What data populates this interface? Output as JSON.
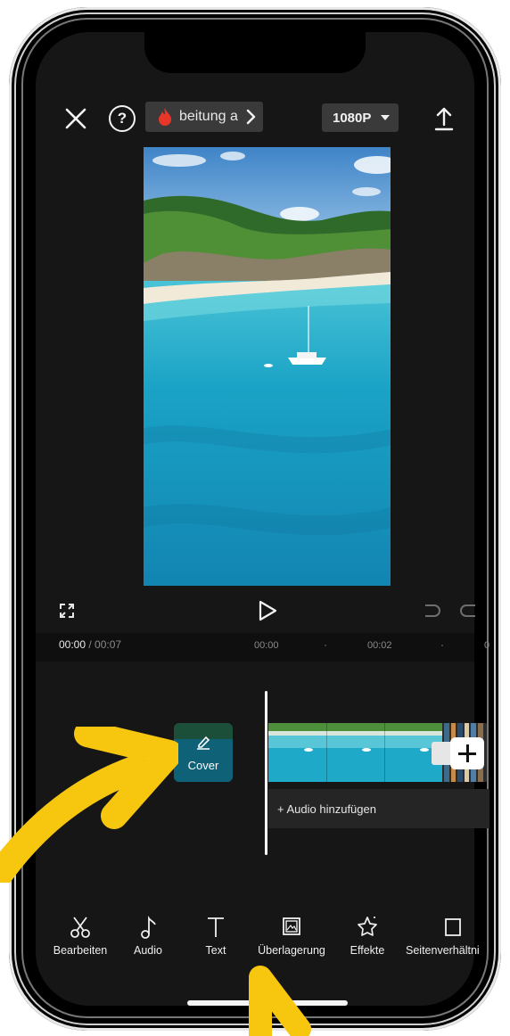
{
  "toolbar": {
    "project_name": "beitung a",
    "resolution": "1080P"
  },
  "timecode": {
    "current": "00:00",
    "separator": " / ",
    "total": "00:07",
    "marks": [
      "00:00",
      "00:02",
      "0"
    ]
  },
  "timeline": {
    "cover_label": "Cover",
    "audio_label": "Audio hinzufügen"
  },
  "bottom_tools": [
    {
      "label": "Bearbeiten",
      "icon": "scissors-icon"
    },
    {
      "label": "Audio",
      "icon": "music-note-icon"
    },
    {
      "label": "Text",
      "icon": "text-icon"
    },
    {
      "label": "Überlagerung",
      "icon": "overlay-icon"
    },
    {
      "label": "Effekte",
      "icon": "effects-star-icon"
    },
    {
      "label": "Seitenverhältni",
      "icon": "aspect-ratio-icon"
    }
  ],
  "colors": {
    "screen_bg": "#161616",
    "chip_bg": "#3a3a3a",
    "accent_flame": "#e8362a",
    "annotation_arrow": "#f7c70f",
    "water": "#1fa6c4"
  }
}
